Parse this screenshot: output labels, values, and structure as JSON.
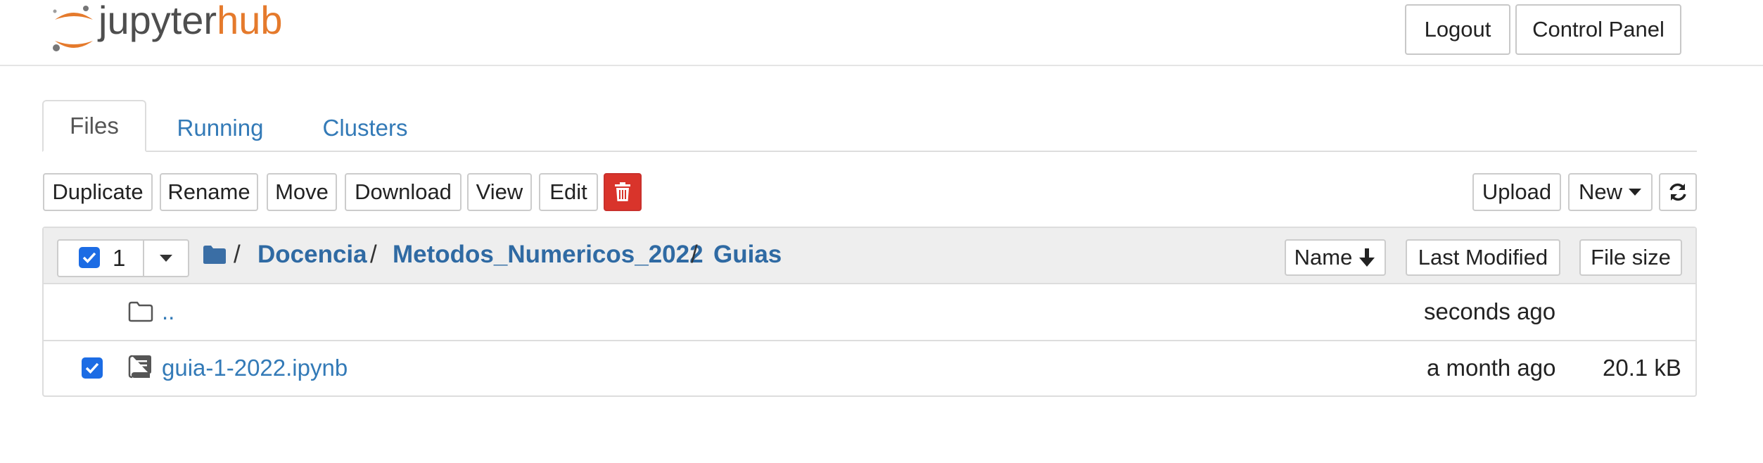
{
  "header": {
    "logo_text_1": "jupyter",
    "logo_text_2": "hub",
    "logout_label": "Logout",
    "control_panel_label": "Control Panel"
  },
  "tabs": [
    {
      "label": "Files",
      "active": true
    },
    {
      "label": "Running",
      "active": false
    },
    {
      "label": "Clusters",
      "active": false
    }
  ],
  "toolbar": {
    "duplicate": "Duplicate",
    "rename": "Rename",
    "move": "Move",
    "download": "Download",
    "view": "View",
    "edit": "Edit",
    "delete_icon": "trash-icon",
    "upload": "Upload",
    "new": "New",
    "refresh_icon": "refresh-icon"
  },
  "list_header": {
    "selected_count": "1",
    "breadcrumb": [
      "Docencia",
      "Metodos_Numericos_2022",
      "Guias"
    ],
    "sort_name": "Name",
    "sort_last_modified": "Last Modified",
    "sort_file_size": "File size"
  },
  "rows": [
    {
      "name": "..",
      "modified": "seconds ago",
      "size": "",
      "checked": false,
      "icon": "folder-icon"
    },
    {
      "name": "guia-1-2022.ipynb",
      "modified": "a month ago",
      "size": "20.1 kB",
      "checked": true,
      "icon": "notebook-icon"
    }
  ],
  "colors": {
    "accent": "#337ab7",
    "checkbox": "#1c6ce4",
    "danger": "#d9342b",
    "logo_orange": "#e57a2c"
  }
}
